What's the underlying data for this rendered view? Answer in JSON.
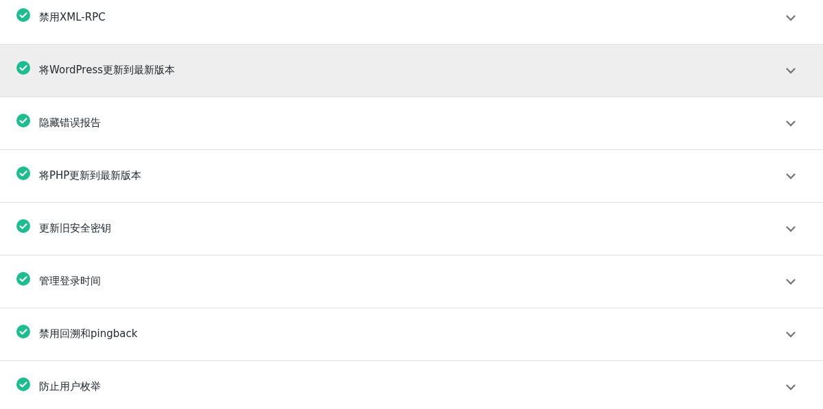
{
  "checks": [
    {
      "label": "禁用XML-RPC",
      "highlighted": false,
      "passed": true
    },
    {
      "label": "将WordPress更新到最新版本",
      "highlighted": true,
      "passed": true
    },
    {
      "label": "隐藏错误报告",
      "highlighted": false,
      "passed": true
    },
    {
      "label": "将PHP更新到最新版本",
      "highlighted": false,
      "passed": true
    },
    {
      "label": "更新旧安全密钥",
      "highlighted": false,
      "passed": true
    },
    {
      "label": "管理登录时间",
      "highlighted": false,
      "passed": true
    },
    {
      "label": "禁用回溯和pingback",
      "highlighted": false,
      "passed": true
    },
    {
      "label": "防止用户枚举",
      "highlighted": false,
      "passed": true
    }
  ]
}
